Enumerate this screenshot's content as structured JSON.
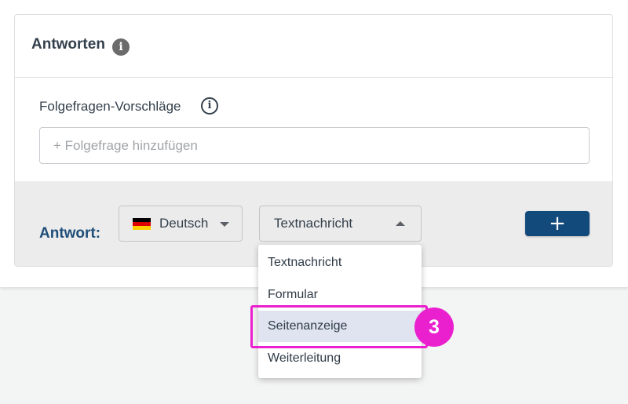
{
  "card": {
    "title": "Antworten",
    "title_info_icon": "info-filled-icon"
  },
  "followup": {
    "label": "Folgefragen-Vorschläge",
    "label_info_icon": "info-outline-icon",
    "input_value": "",
    "input_placeholder": "+ Folgefrage hinzufügen"
  },
  "answer": {
    "label": "Antwort:",
    "language": {
      "flag_icon": "flag-germany-icon",
      "selected": "Deutsch",
      "caret_icon": "chevron-down-icon"
    },
    "type": {
      "selected": "Textnachricht",
      "caret_icon": "chevron-up-icon",
      "options": [
        "Textnachricht",
        "Formular",
        "Seitenanzeige",
        "Weiterleitung"
      ],
      "highlighted_option": "Seitenanzeige"
    },
    "add_button": {
      "label": "+",
      "color": "#134a7c"
    }
  },
  "annotation": {
    "step_number": "3",
    "color": "#ea1fce"
  },
  "colors": {
    "heading": "#34404c",
    "answer_label": "#1f4e79",
    "highlight_row": "#dfe4f0"
  }
}
